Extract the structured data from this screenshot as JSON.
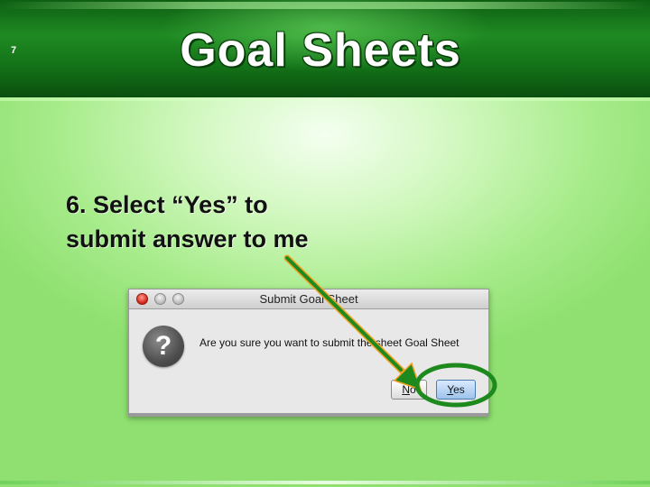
{
  "slide": {
    "number": "7",
    "title": "Goal Sheets",
    "instruction_lines": [
      "6. Select “Yes” to",
      "submit answer to me"
    ]
  },
  "dialog": {
    "title": "Submit Goal Sheet",
    "message": "Are you sure you want to submit the sheet Goal Sheet",
    "icon": "question-icon",
    "no_mnemonic": "N",
    "no_rest": "o",
    "yes_mnemonic": "Y",
    "yes_rest": "es"
  },
  "annotation": {
    "arrow_color": "#1e8a1e",
    "arrow_head_color": "#f0a020",
    "circle_color": "#1e8a1e"
  },
  "colors": {
    "header_green": "#137318",
    "background_green": "#a8ec8c"
  }
}
